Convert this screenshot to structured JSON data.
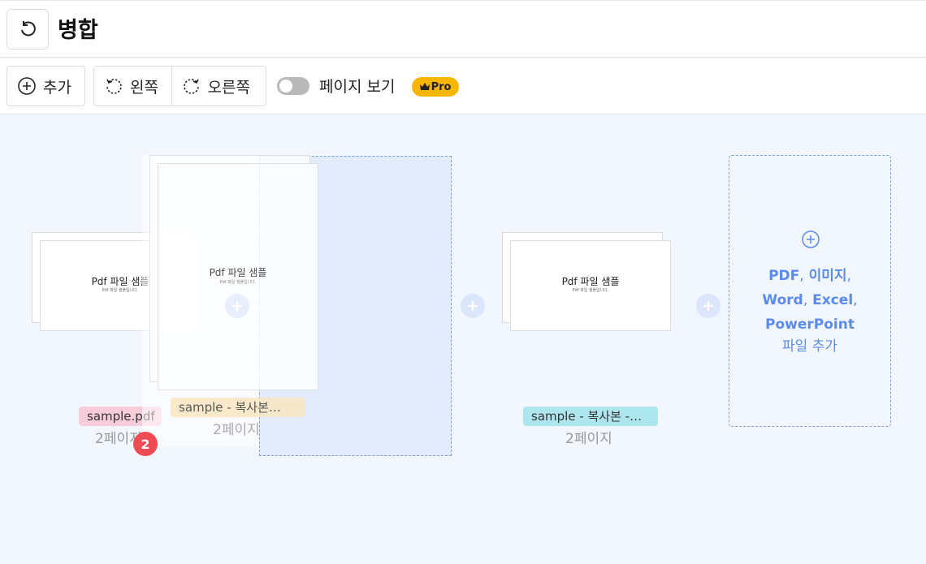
{
  "header": {
    "title": "병합"
  },
  "toolbar": {
    "add_label": "추가",
    "rotate_left_label": "왼쪽",
    "rotate_right_label": "오른쪽",
    "page_view_label": "페이지 보기",
    "pro_label": "Pro",
    "page_view_enabled": false
  },
  "files": [
    {
      "name": "sample.pdf",
      "pages": "2페이지",
      "page_title": "Pdf 파일 샘플",
      "page_sub": "Pdf 파일 샘플입니다.",
      "color": "#f8ccd9"
    },
    {
      "name": "sample - 복사본…",
      "pages": "2페이지",
      "page_title": "Pdf 파일 샘플",
      "page_sub": "Pdf 파일 샘플입니다.",
      "color": "#f9e6c0"
    },
    {
      "name": "sample - 복사본 -…",
      "pages": "2페이지",
      "page_title": "Pdf 파일 샘플",
      "page_sub": "Pdf 파일 샘플입니다.",
      "color": "#aee6ee"
    }
  ],
  "drag_badge": "2",
  "drop_zone": {
    "types": [
      "PDF",
      "이미지",
      "Word",
      "Excel",
      "PowerPoint"
    ],
    "separator": ",",
    "sub_label": "파일 추가"
  },
  "colors": {
    "accent": "#5b8bec",
    "pro": "#f9b600",
    "badge": "#ef4b55"
  }
}
